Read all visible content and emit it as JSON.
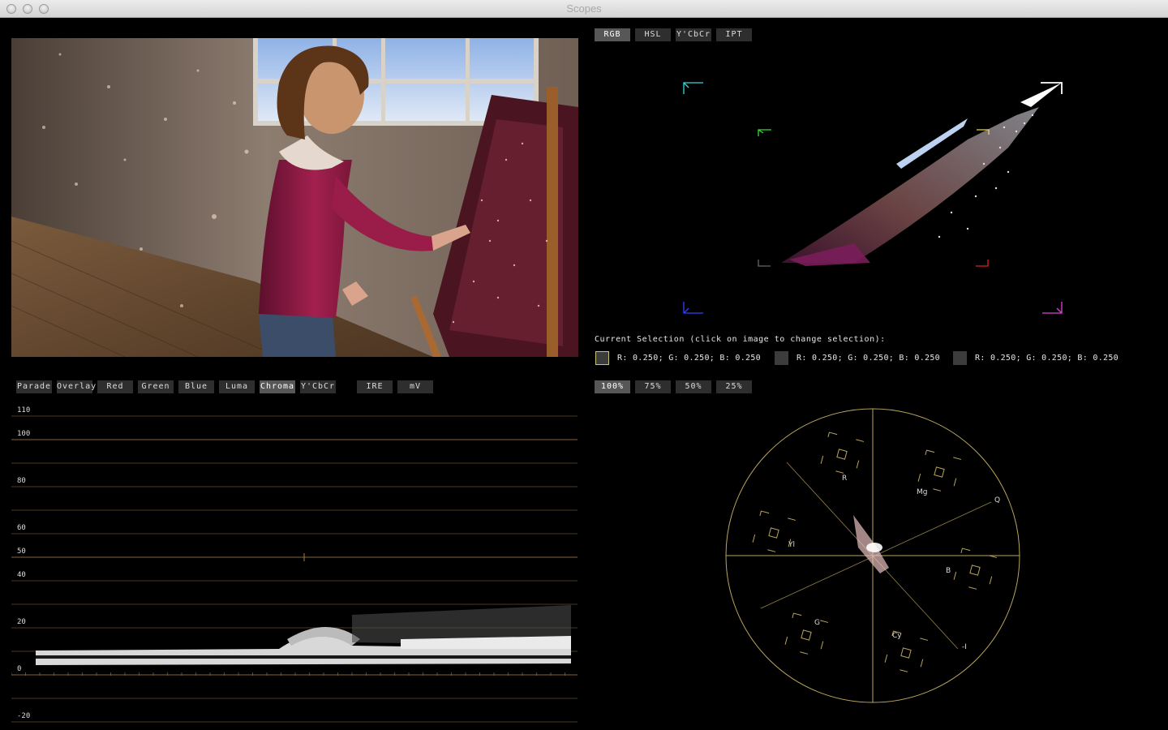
{
  "window": {
    "title": "Scopes"
  },
  "colorspace_tabs": [
    "RGB",
    "HSL",
    "Y'CbCr",
    "IPT"
  ],
  "colorspace_active": "RGB",
  "waveform_tabs": [
    "Parade",
    "Overlay",
    "Red",
    "Green",
    "Blue",
    "Luma",
    "Chroma",
    "Y'CbCr"
  ],
  "waveform_active": "Chroma",
  "unit_tabs": [
    "IRE",
    "mV"
  ],
  "zoom_tabs": [
    "100%",
    "75%",
    "50%",
    "25%"
  ],
  "zoom_active": "100%",
  "selection": {
    "label": "Current Selection (click on image to change selection):",
    "swatches": [
      {
        "text": "R: 0.250; G: 0.250; B: 0.250",
        "color": "#3c3c3c"
      },
      {
        "text": "R: 0.250; G: 0.250; B: 0.250",
        "color": "#3c3c3c"
      },
      {
        "text": "R: 0.250; G: 0.250; B: 0.250",
        "color": "#3c3c3c"
      }
    ]
  },
  "waveform_scale": [
    "110",
    "100",
    "80",
    "60",
    "50",
    "40",
    "20",
    "0",
    "-20"
  ],
  "vectorscope_labels": [
    "R",
    "Mg",
    "Q",
    "Yl",
    "B",
    "G",
    "Cy",
    "-I"
  ],
  "colors": {
    "graticule": "#8a6a3a",
    "vectorscope": "#b9a45c",
    "selected_swatch_border": "#c8c27a"
  }
}
